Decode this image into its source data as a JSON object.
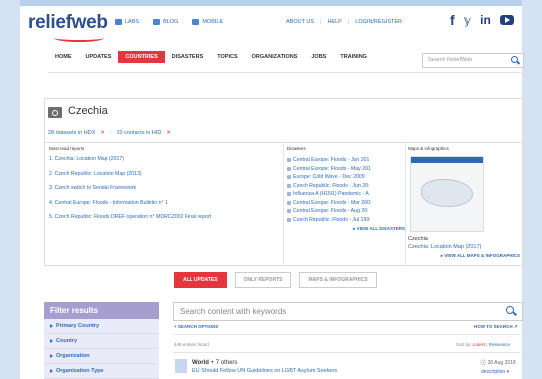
{
  "header": {
    "logo": "reliefweb",
    "top_links": [
      "LABS",
      "BLOG",
      "MOBILE"
    ],
    "account_links": [
      "ABOUT US",
      "HELP",
      "LOGIN/REGISTER"
    ],
    "social": {
      "facebook": "f",
      "twitter": "𝕪",
      "linkedin": "in"
    }
  },
  "nav": {
    "items": [
      "HOME",
      "UPDATES",
      "COUNTRIES",
      "DISASTERS",
      "TOPICS",
      "ORGANIZATIONS",
      "JOBS",
      "TRAINING"
    ],
    "active": "COUNTRIES",
    "search_placeholder": "Search ReliefWeb"
  },
  "country": {
    "name": "Czechia",
    "hdx_link": "28 datasets in HDX",
    "hid_link": "10 contacts in HID",
    "close_glyph": "✕"
  },
  "most_read": {
    "heading": "Most read reports",
    "items": [
      "1. Czechia: Location Map (2017)",
      "2. Czech Republic: Location Map (2013)",
      "3. Czech switch to Sendai Framework",
      "4. Central Europe: Floods - Information Bulletin n° 1",
      "5. Czech Republic: Floods DREF operation n° MDRCZ002 Final report"
    ]
  },
  "disasters": {
    "heading": "Disasters",
    "items": [
      "Central Europe: Floods - Jun 201",
      "Central Europe: Floods - May 201",
      "Europe: Cold Wave - Dec 2009",
      "Czech Republic: Floods - Jun 20:",
      "Influenza A (H1N1) Pandemic - A",
      "Central Europe: Floods - Mar 200:",
      "Central Europe: Floods - Aug 20:",
      "Czech Republic: Floods - Jul 199:"
    ],
    "view_all": "▸ VIEW ALL DISASTERS"
  },
  "maps": {
    "heading": "Maps & infographics",
    "caption": "Czechia",
    "link": "Czechia: Location Map (2017)",
    "view_all": "▸ VIEW ALL MAPS & INFOGRAPHICS"
  },
  "tabs": [
    "ALL UPDATES",
    "ONLY REPORTS",
    "MAPS & INFOGRAPHICS"
  ],
  "filter": {
    "heading": "Filter results",
    "items": [
      "Primary Country",
      "Country",
      "Organization",
      "Organization Type"
    ]
  },
  "content_search": {
    "placeholder": "Search content with keywords",
    "search_options": "+ SEARCH OPTIONS",
    "how_to": "HOW TO SEARCH ↗",
    "found": "448 entries found",
    "sort_label": "Sort by:",
    "sort_latest": "Latest",
    "sort_sep": " | ",
    "sort_relevance": "Relevance"
  },
  "result": {
    "source_country": "World",
    "source_others": " + 7 others",
    "title": "EU Should Follow UN Guidelines on LGBT Asylum Seekers",
    "date": "🕓 30 Aug 2018",
    "description": "description ▾"
  },
  "colors": {
    "accent_red": "#e5363d",
    "link_blue": "#2d6cb5",
    "brand_navy": "#2d4f8c",
    "filter_purple": "#a79ed0"
  }
}
